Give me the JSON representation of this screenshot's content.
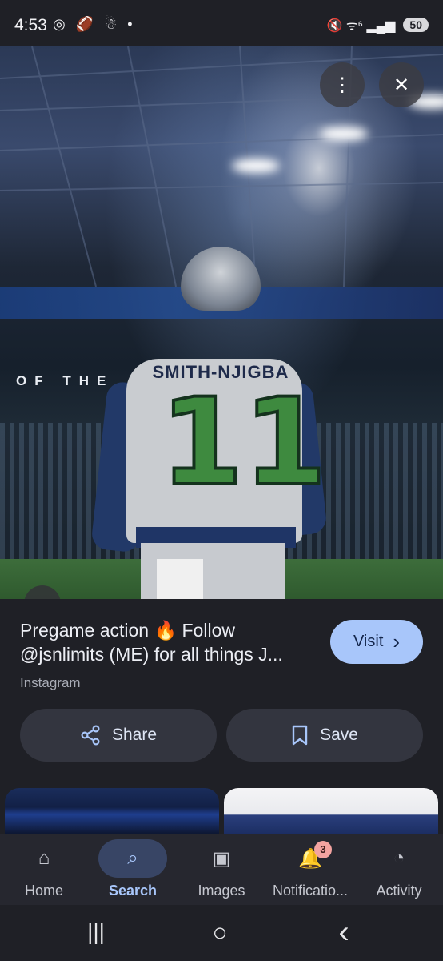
{
  "status_bar": {
    "time": "4:53",
    "left_icons": "◎ 🏈 ☃ •",
    "right_icons": "🔇 ᯤ⁶ ▂▄▆",
    "battery": "50"
  },
  "hero": {
    "nameplate": "SMITH-NJIGBA",
    "jersey_number": "11",
    "stadium_text": "OF THE",
    "more_icon": "⋮",
    "close_icon": "✕",
    "lens_icon": "⊡"
  },
  "result": {
    "title_line1": "Pregame action 🔥 Follow",
    "title_line2": "@jsnlimits (ME) for all things J...",
    "source": "Instagram",
    "visit_label": "Visit",
    "visit_chevron": "›"
  },
  "actions": {
    "share_label": "Share",
    "share_icon": "⋖",
    "save_label": "Save",
    "save_icon": "⌑"
  },
  "bottom_nav": {
    "items": [
      {
        "label": "Home",
        "icon": "⌂"
      },
      {
        "label": "Search",
        "icon": "⌕"
      },
      {
        "label": "Images",
        "icon": "▣"
      },
      {
        "label": "Notificatio...",
        "icon": "🔔",
        "badge": "3"
      },
      {
        "label": "Activity",
        "icon": "◔"
      }
    ]
  },
  "system_nav": {
    "recents": "|||",
    "home": "○",
    "back": "‹"
  }
}
